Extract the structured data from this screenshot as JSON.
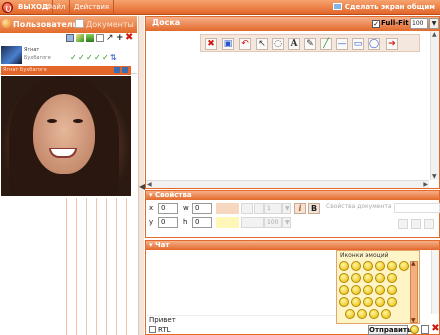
{
  "topbar": {
    "exit_label": "ВЫХОД",
    "file_label": "Файл",
    "actions_label": "Действия",
    "share_screen_label": "Сделать экран общим"
  },
  "left_panel": {
    "tabs": [
      {
        "label": "Пользователи",
        "icon": "users-icon",
        "active": true
      },
      {
        "label": "Документы",
        "icon": "documents-icon",
        "active": false
      }
    ],
    "user": {
      "name": "Ягнат",
      "status": "Бухбагоге"
    },
    "video_title": "Ягнат Бухбагоге"
  },
  "board": {
    "title": "Доска",
    "fullfit_label": "Full-Fit",
    "fullfit_checked": true,
    "zoom_value": "100",
    "tools": [
      {
        "name": "clear-icon",
        "glyph": "✖"
      },
      {
        "name": "open-doc-icon",
        "glyph": "▣"
      },
      {
        "name": "undo-icon",
        "glyph": "↶"
      },
      {
        "name": "pointer-icon",
        "glyph": "↖"
      },
      {
        "name": "lasso-icon",
        "glyph": "◌"
      },
      {
        "name": "text-icon",
        "glyph": "A"
      },
      {
        "name": "pencil-icon",
        "glyph": "✎"
      },
      {
        "name": "highlighter-icon",
        "glyph": "╱"
      },
      {
        "name": "line-icon",
        "glyph": "—"
      },
      {
        "name": "rectangle-icon",
        "glyph": "▭"
      },
      {
        "name": "ellipse-icon",
        "glyph": "◯"
      },
      {
        "name": "arrow-right-icon",
        "glyph": "➔"
      }
    ]
  },
  "properties": {
    "title": "Свойства",
    "x_label": "x",
    "x_value": "0",
    "y_label": "y",
    "y_value": "0",
    "w_label": "w",
    "w_value": "0",
    "h_label": "h",
    "h_value": "0",
    "line_width": "1",
    "opacity": "100",
    "italic_label": "i",
    "bold_label": "B",
    "doc_props_label": "Свойства документа"
  },
  "chat": {
    "title": "Чат",
    "input_value": "Привет",
    "rtl_label": "RTL",
    "send_label": "Отправить"
  },
  "emoticons": {
    "title": "Иконки эмоций"
  },
  "colors": {
    "accent": "#e2662a",
    "header_light": "#f6a36e",
    "panel_border": "#e26a2c"
  }
}
